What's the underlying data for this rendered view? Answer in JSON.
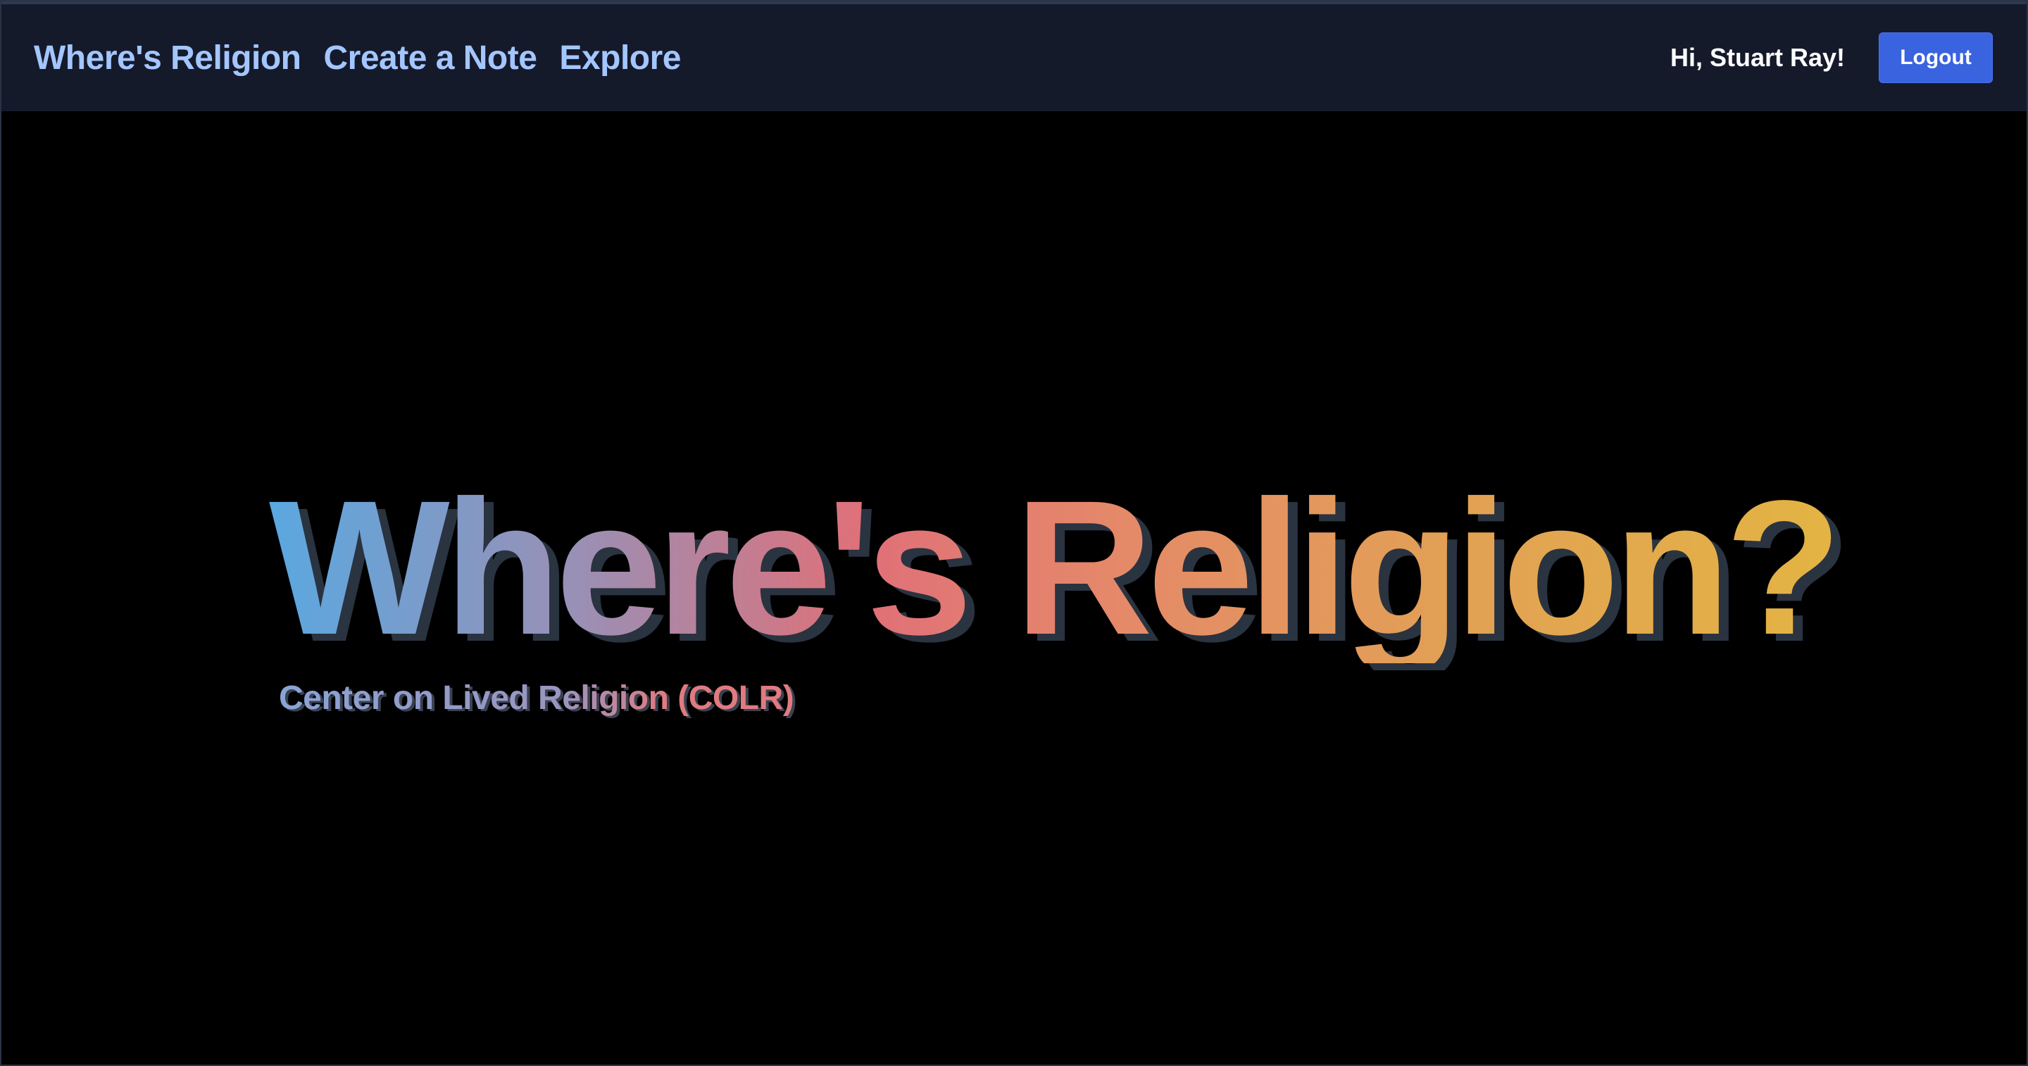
{
  "nav": {
    "brand": "Where's Religion",
    "create_note": "Create a Note",
    "explore": "Explore"
  },
  "user": {
    "greeting": "Hi, Stuart Ray!",
    "logout_label": "Logout"
  },
  "hero": {
    "title": "Where's Religion?",
    "subtitle": "Center on Lived Religion (COLR)"
  },
  "colors": {
    "topbar_bg": "#151a2b",
    "nav_link": "#a4c6ff",
    "logout_bg": "#3a63e0",
    "gradient_start": "#5aa8e0",
    "gradient_mid": "#e07078",
    "gradient_end": "#e3b443"
  }
}
